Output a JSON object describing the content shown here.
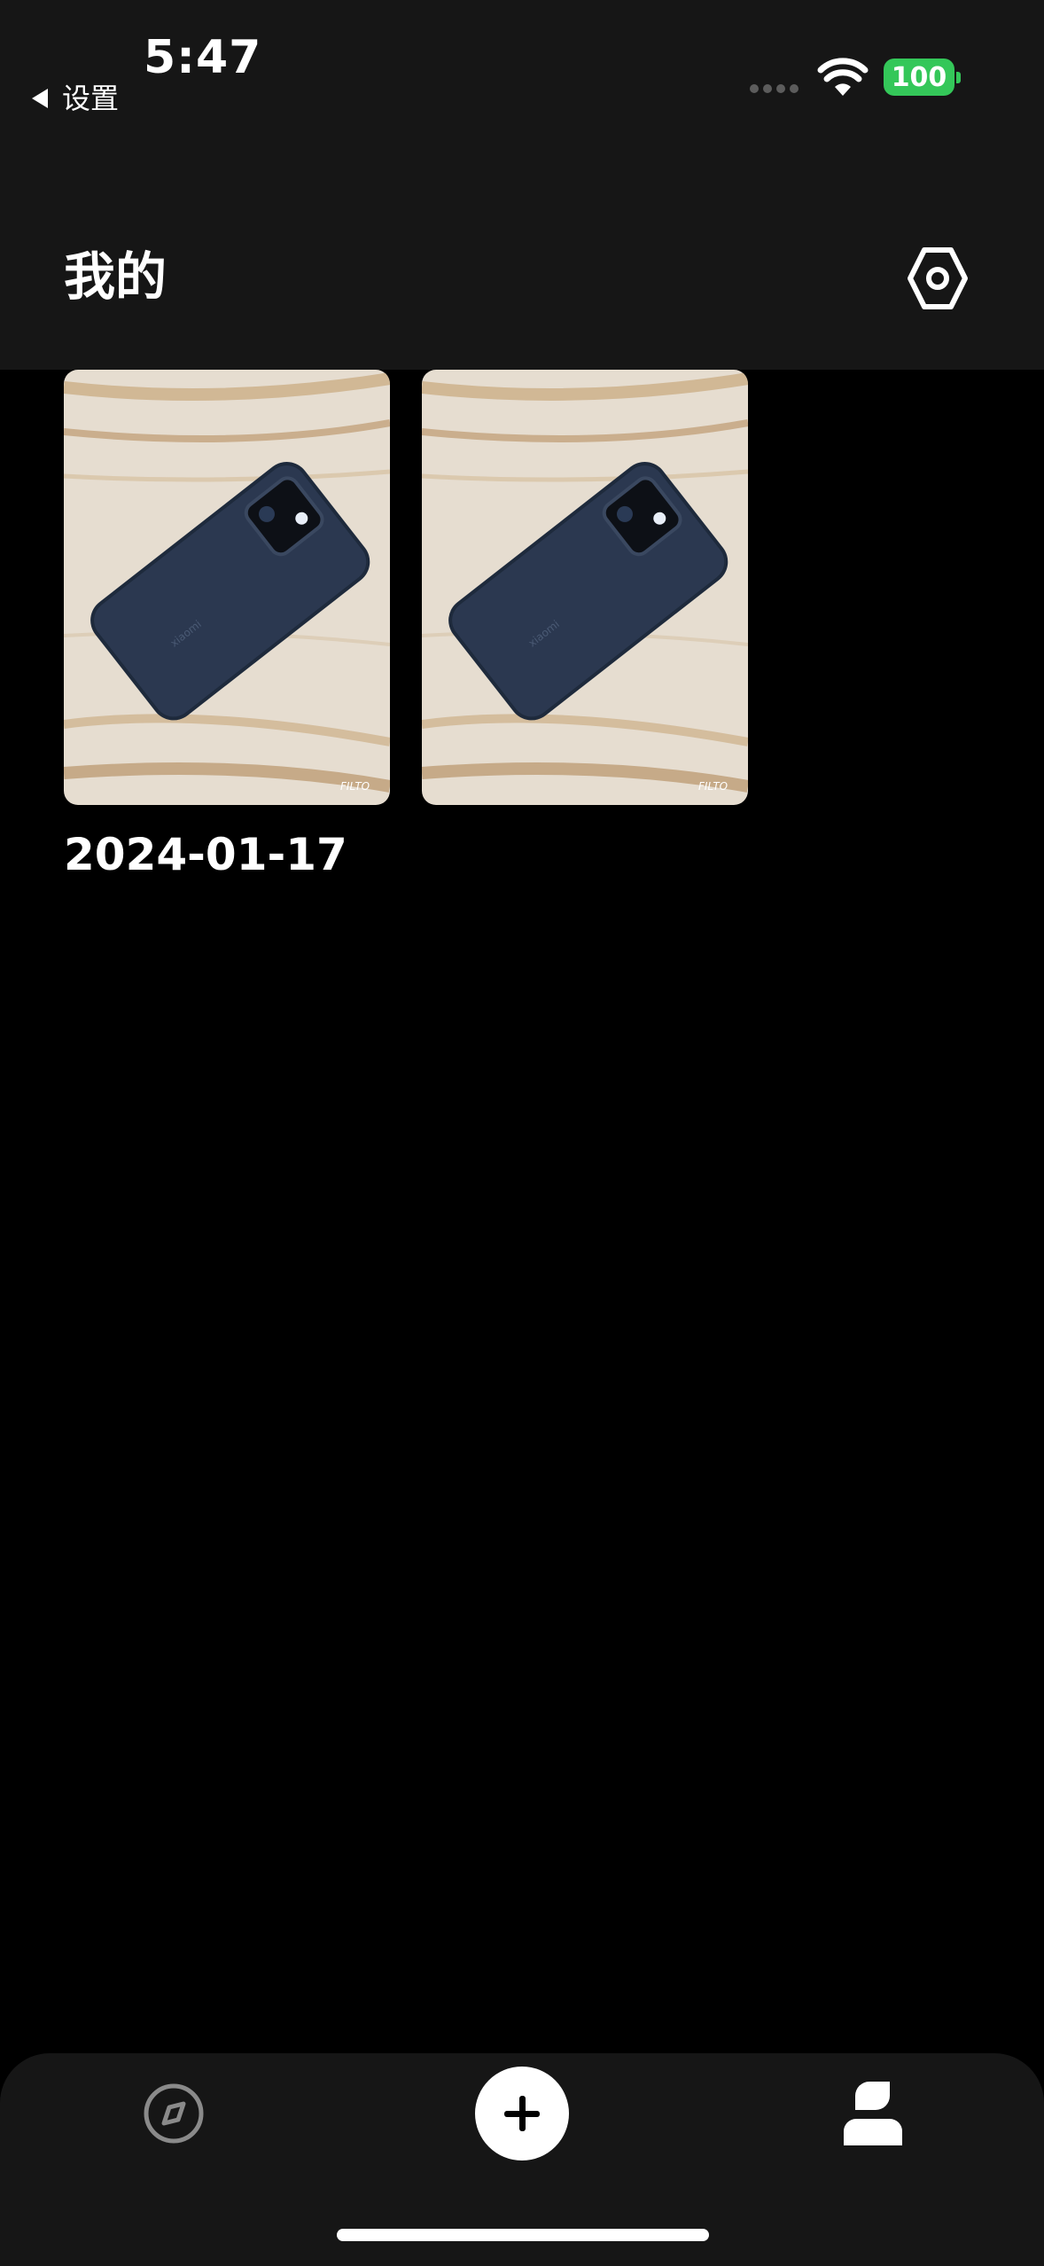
{
  "status_bar": {
    "time": "5:47",
    "back_label": "设置",
    "battery": "100"
  },
  "header": {
    "title": "我的"
  },
  "photos": [
    {
      "watermark": "FILTO"
    },
    {
      "watermark": "FILTO"
    }
  ],
  "date_group": "2024-01-17",
  "tab_bar": {
    "items": [
      "compass-icon",
      "plus-icon",
      "person-icon"
    ]
  },
  "colors": {
    "background": "#000000",
    "header_bg": "#161616",
    "battery_green": "#34c759",
    "phone_blue": "#2b3850",
    "wood": "#e6ddd0"
  }
}
